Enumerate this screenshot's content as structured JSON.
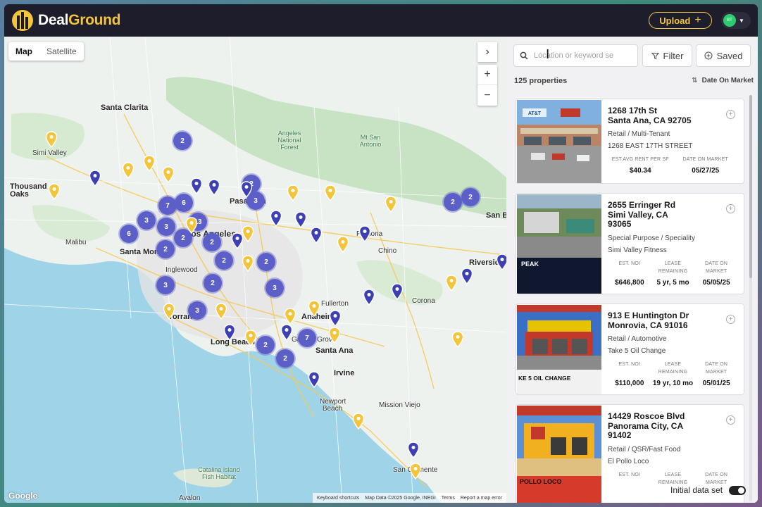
{
  "header": {
    "brand_left": "Deal",
    "brand_right": "Ground",
    "upload_label": "Upload",
    "avatar_initials": "BT"
  },
  "map": {
    "tabs": [
      "Map",
      "Satellite"
    ],
    "active_tab": "Map",
    "places": [
      "Santa Clarita",
      "Simi Valley",
      "Thousand Oaks",
      "Angeles National Forest",
      "Mt San Antonio",
      "Pasadena",
      "Los Angeles",
      "Malibu",
      "Santa Monica",
      "Inglewood",
      "Torrance",
      "Long Beach",
      "Anaheim",
      "Santa Ana",
      "Irvine",
      "Newport Beach",
      "Mission Viejo",
      "San Clemente",
      "Chino",
      "Corona",
      "Riverside",
      "San Bernardino",
      "Pomona",
      "Fullerton",
      "Garden Grove",
      "Catalina Island Fish Habitat",
      "Avalon"
    ],
    "clusters": [
      "2",
      "2",
      "3",
      "6",
      "7",
      "13",
      "3",
      "3",
      "6",
      "2",
      "2",
      "2",
      "2",
      "2",
      "3",
      "2",
      "3",
      "3",
      "2",
      "7",
      "2",
      "2",
      "2"
    ],
    "footer": [
      "Keyboard shortcuts",
      "Map Data ©2025 Google, INEGI",
      "Terms",
      "Report a map error"
    ],
    "google_label": "Google"
  },
  "panel": {
    "search_placeholder": "Location or keyword se",
    "filter_label": "Filter",
    "saved_label": "Saved",
    "count_label": "125 properties",
    "sort_label": "Date On Market",
    "properties": [
      {
        "addr1": "1268 17th St",
        "addr2": "Santa Ana, CA 92705",
        "type": "Retail / Multi-Tenant",
        "name": "1268 EAST 17TH STREET",
        "stats": [
          {
            "label": "EST.AVG RENT PER SF",
            "value": "$40.34"
          },
          {
            "label": "DATE ON MARKET",
            "value": "05/27/25"
          }
        ]
      },
      {
        "addr1": "2655 Erringer Rd",
        "addr2": "Simi Valley, CA 93065",
        "type": "Special Purpose / Speciality",
        "name": "Simi Valley Fitness",
        "stats": [
          {
            "label": "EST. NOI",
            "value": "$646,800"
          },
          {
            "label": "LEASE REMAINING",
            "value": "5 yr, 5 mo"
          },
          {
            "label": "DATE ON MARKET",
            "value": "05/05/25"
          }
        ]
      },
      {
        "addr1": "913 E Huntington Dr",
        "addr2": "Monrovia, CA 91016",
        "type": "Retail / Automotive",
        "name": "Take 5 Oil Change",
        "stats": [
          {
            "label": "EST. NOI",
            "value": "$110,000"
          },
          {
            "label": "LEASE REMAINING",
            "value": "19 yr, 10 mo"
          },
          {
            "label": "DATE ON MARKET",
            "value": "05/01/25"
          }
        ]
      },
      {
        "addr1": "14429 Roscoe Blvd",
        "addr2": "Panorama City, CA 91402",
        "type": "Retail / QSR/Fast Food",
        "name": "El Pollo Loco",
        "stats": [
          {
            "label": "EST. NOI",
            "value": ""
          },
          {
            "label": "LEASE REMAINING",
            "value": ""
          },
          {
            "label": "DATE ON MARKET",
            "value": ""
          }
        ]
      }
    ],
    "card_images": {
      "img1_text": "AT&T",
      "img2_text": "PEAK",
      "img3_text": "KE 5 OIL CHANGE",
      "img4_text": "POLLO LOCO"
    },
    "initial_dataset_label": "Initial data set"
  },
  "colors": {
    "topbar": "#1d1d2c",
    "brand_yellow": "#f3c53a",
    "cluster": "#5c5fc7",
    "pin_blue": "#3d3fb5",
    "pin_yellow": "#f3c53a"
  }
}
